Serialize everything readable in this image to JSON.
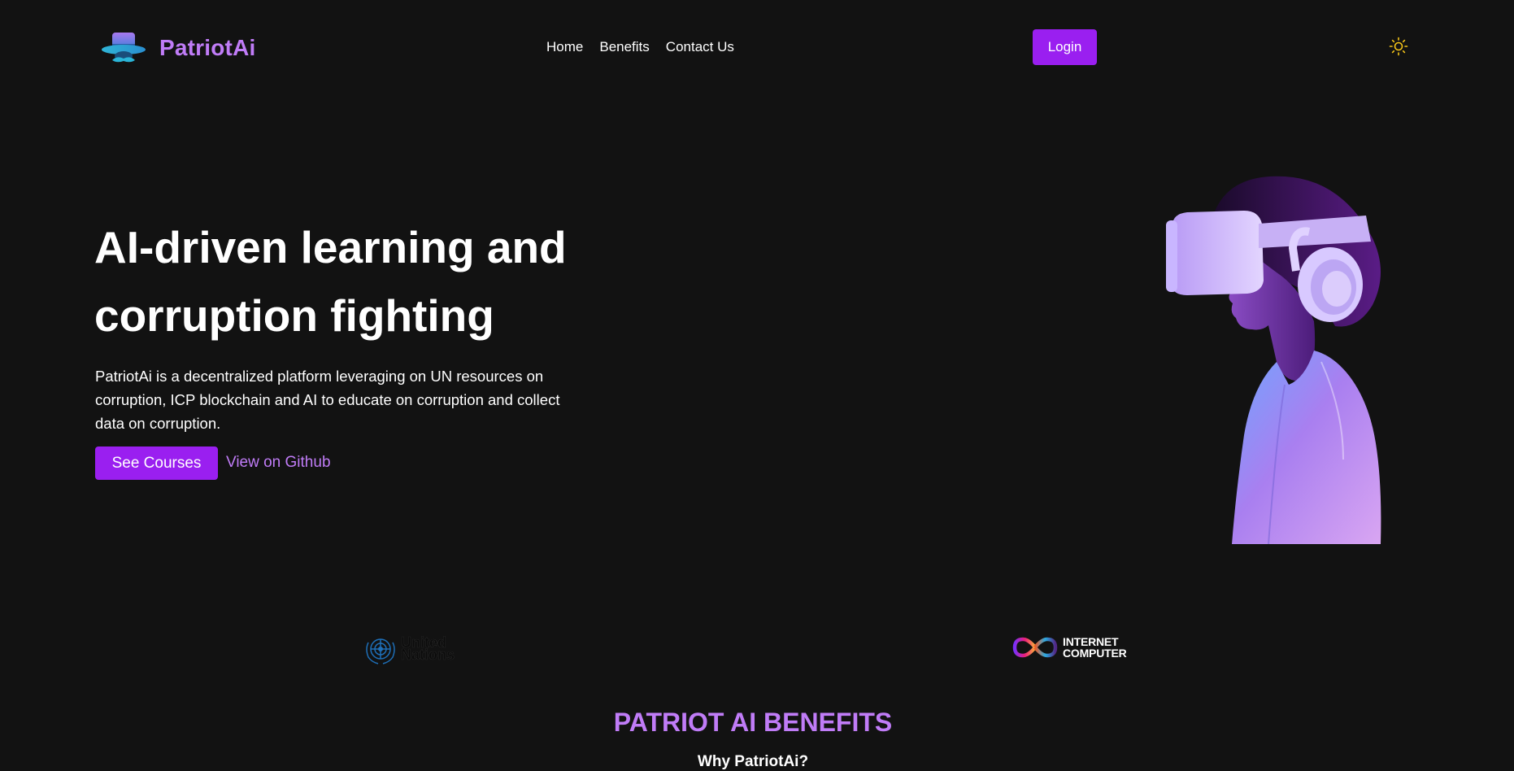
{
  "header": {
    "brand_name": "PatriotAi",
    "nav": [
      {
        "label": "Home"
      },
      {
        "label": "Benefits"
      },
      {
        "label": "Contact Us"
      }
    ],
    "login_label": "Login",
    "theme_icon": "sun-icon"
  },
  "hero": {
    "title_line1": "AI-driven learning and",
    "title_line2": "corruption fighting",
    "description": "PatriotAi is a decentralized platform leveraging on UN resources on corruption, ICP blockchain and AI to educate on corruption and collect data on corruption.",
    "primary_cta": "See Courses",
    "secondary_cta": "View on Github",
    "image": "vr-headset-woman-illustration"
  },
  "partners": {
    "un": {
      "line1": "United",
      "line2": "Nations",
      "icon": "un-emblem-icon"
    },
    "icp": {
      "line1": "INTERNET",
      "line2": "COMPUTER",
      "icon": "infinity-icon"
    }
  },
  "benefits": {
    "title": "PATRIOT AI BENEFITS",
    "subtitle": "Why PatriotAi?"
  },
  "colors": {
    "background": "#121212",
    "accent": "#9a1ff0",
    "accent_text": "#c07cf7",
    "sun": "#f5c518"
  }
}
